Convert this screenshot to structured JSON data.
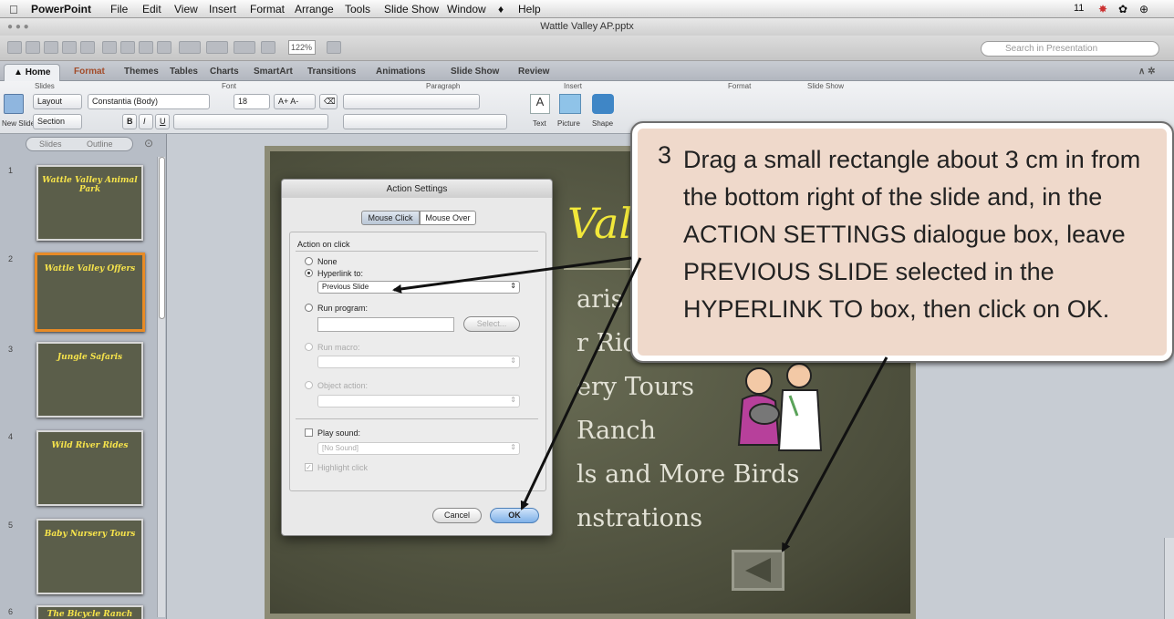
{
  "menubar": {
    "apple": "",
    "app": "PowerPoint",
    "items": [
      "File",
      "Edit",
      "View",
      "Insert",
      "Format",
      "Arrange",
      "Tools",
      "Slide Show",
      "Window",
      "♦",
      "Help"
    ],
    "status": "11"
  },
  "window": {
    "title": "Wattle Valley AP.pptx"
  },
  "toolbar": {
    "zoom": "122%",
    "search_placeholder": "Search in Presentation"
  },
  "ribbon_tabs": [
    "Home",
    "Format",
    "Themes",
    "Tables",
    "Charts",
    "SmartArt",
    "Transitions",
    "Animations",
    "Slide Show",
    "Review"
  ],
  "ribbon": {
    "groups": [
      "Slides",
      "Font",
      "Paragraph",
      "Insert",
      "Format",
      "Slide Show"
    ],
    "new_slide": "New Slide",
    "layout": "Layout",
    "section": "Section",
    "font_name": "Constantia (Body)",
    "font_size": "18",
    "bold": "B",
    "italic": "I",
    "underline": "U",
    "text_label": "Text",
    "picture_label": "Picture",
    "shape_label": "Shape"
  },
  "left_pane": {
    "tabs": [
      "Slides",
      "Outline"
    ],
    "slides": [
      {
        "num": "1",
        "title": "Wattle Valley Animal Park"
      },
      {
        "num": "2",
        "title": "Wattle Valley Offers"
      },
      {
        "num": "3",
        "title": "Jungle Safaris"
      },
      {
        "num": "4",
        "title": "Wild River Rides"
      },
      {
        "num": "5",
        "title": "Baby Nursery Tours"
      },
      {
        "num": "6",
        "title": "The Bicycle Ranch"
      }
    ]
  },
  "slide": {
    "title_fragment": "Valle",
    "bullets": [
      "aris",
      "r Rides",
      "ery Tours",
      "Ranch",
      "ls and More Birds",
      "nstrations"
    ],
    "back_button_icon": "left-triangle-icon"
  },
  "dialog": {
    "title": "Action Settings",
    "tabs": [
      "Mouse Click",
      "Mouse Over"
    ],
    "section": "Action on click",
    "options": {
      "none": "None",
      "hyperlink": "Hyperlink to:",
      "hyperlink_value": "Previous Slide",
      "run_program": "Run program:",
      "select_button": "Select...",
      "run_macro": "Run macro:",
      "object_action": "Object action:"
    },
    "play_sound": "Play sound:",
    "sound_value": "[No Sound]",
    "highlight_click": "Highlight click",
    "cancel": "Cancel",
    "ok": "OK"
  },
  "callout": {
    "number": "3",
    "text": "Drag a small rectangle about 3 cm in from the bottom right of the slide and, in the ACTION SETTINGS dialogue box, leave PREVIOUS SLIDE selected in the HYPERLINK TO box, then click on OK."
  },
  "colors": {
    "accent": "#e78b27",
    "slide_title": "#f2e83a",
    "callout_bg": "#efd9cb"
  }
}
